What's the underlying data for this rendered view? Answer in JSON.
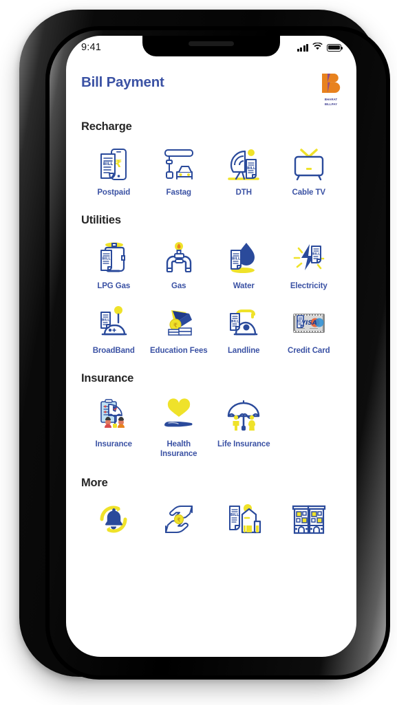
{
  "device": {
    "status_bar": {
      "time": "9:41",
      "signal_icon": "signal-bars-icon",
      "wifi_icon": "wifi-icon",
      "battery_icon": "battery-full-icon"
    }
  },
  "header": {
    "title": "Bill Payment",
    "logo": {
      "name": "bharat-billpay-logo",
      "line1": "BHARAT",
      "line2": "BILLPAY",
      "letter": "B",
      "orange": "#E8821E",
      "purple": "#7B3FA0",
      "text_color": "#3B3B8F"
    }
  },
  "theme": {
    "label_blue": "#3B52A4",
    "icon_blue": "#2A4A9B",
    "icon_yellow": "#EFE22A",
    "heading_dark": "#262626",
    "screen_bg": "#FFFFFF"
  },
  "sections": [
    {
      "id": "recharge",
      "title": "Recharge",
      "items": [
        {
          "label": "Postpaid",
          "icon": "postpaid-bill-phone-icon"
        },
        {
          "label": "Fastag",
          "icon": "fastag-toll-car-icon"
        },
        {
          "label": "DTH",
          "icon": "dth-satellite-dish-icon"
        },
        {
          "label": "Cable TV",
          "icon": "cable-tv-icon"
        }
      ]
    },
    {
      "id": "utilities",
      "title": "Utilities",
      "items": [
        {
          "label": "LPG Gas",
          "icon": "lpg-gas-cylinder-icon"
        },
        {
          "label": "Gas",
          "icon": "gas-pipeline-flame-icon"
        },
        {
          "label": "Water",
          "icon": "water-droplet-bill-icon"
        },
        {
          "label": "Electricity",
          "icon": "electricity-bolt-bill-icon"
        },
        {
          "label": "BroadBand",
          "icon": "broadband-router-icon"
        },
        {
          "label": "Education Fees",
          "icon": "education-graduation-cap-icon"
        },
        {
          "label": "Landline",
          "icon": "landline-telephone-icon"
        },
        {
          "label": "Credit Card",
          "icon": "credit-card-icon"
        }
      ]
    },
    {
      "id": "insurance",
      "title": "Insurance",
      "items": [
        {
          "label": "Insurance",
          "icon": "insurance-family-umbrella-icon"
        },
        {
          "label": "Health Insurance",
          "icon": "health-heart-hand-icon"
        },
        {
          "label": "Life Insurance",
          "icon": "life-umbrella-people-icon"
        }
      ]
    },
    {
      "id": "more",
      "title": "More",
      "items": [
        {
          "label": "",
          "icon": "subscription-bell-refresh-icon"
        },
        {
          "label": "",
          "icon": "money-transfer-hands-icon"
        },
        {
          "label": "",
          "icon": "municipal-tax-building-icon"
        },
        {
          "label": "",
          "icon": "housing-society-icon"
        }
      ]
    }
  ]
}
